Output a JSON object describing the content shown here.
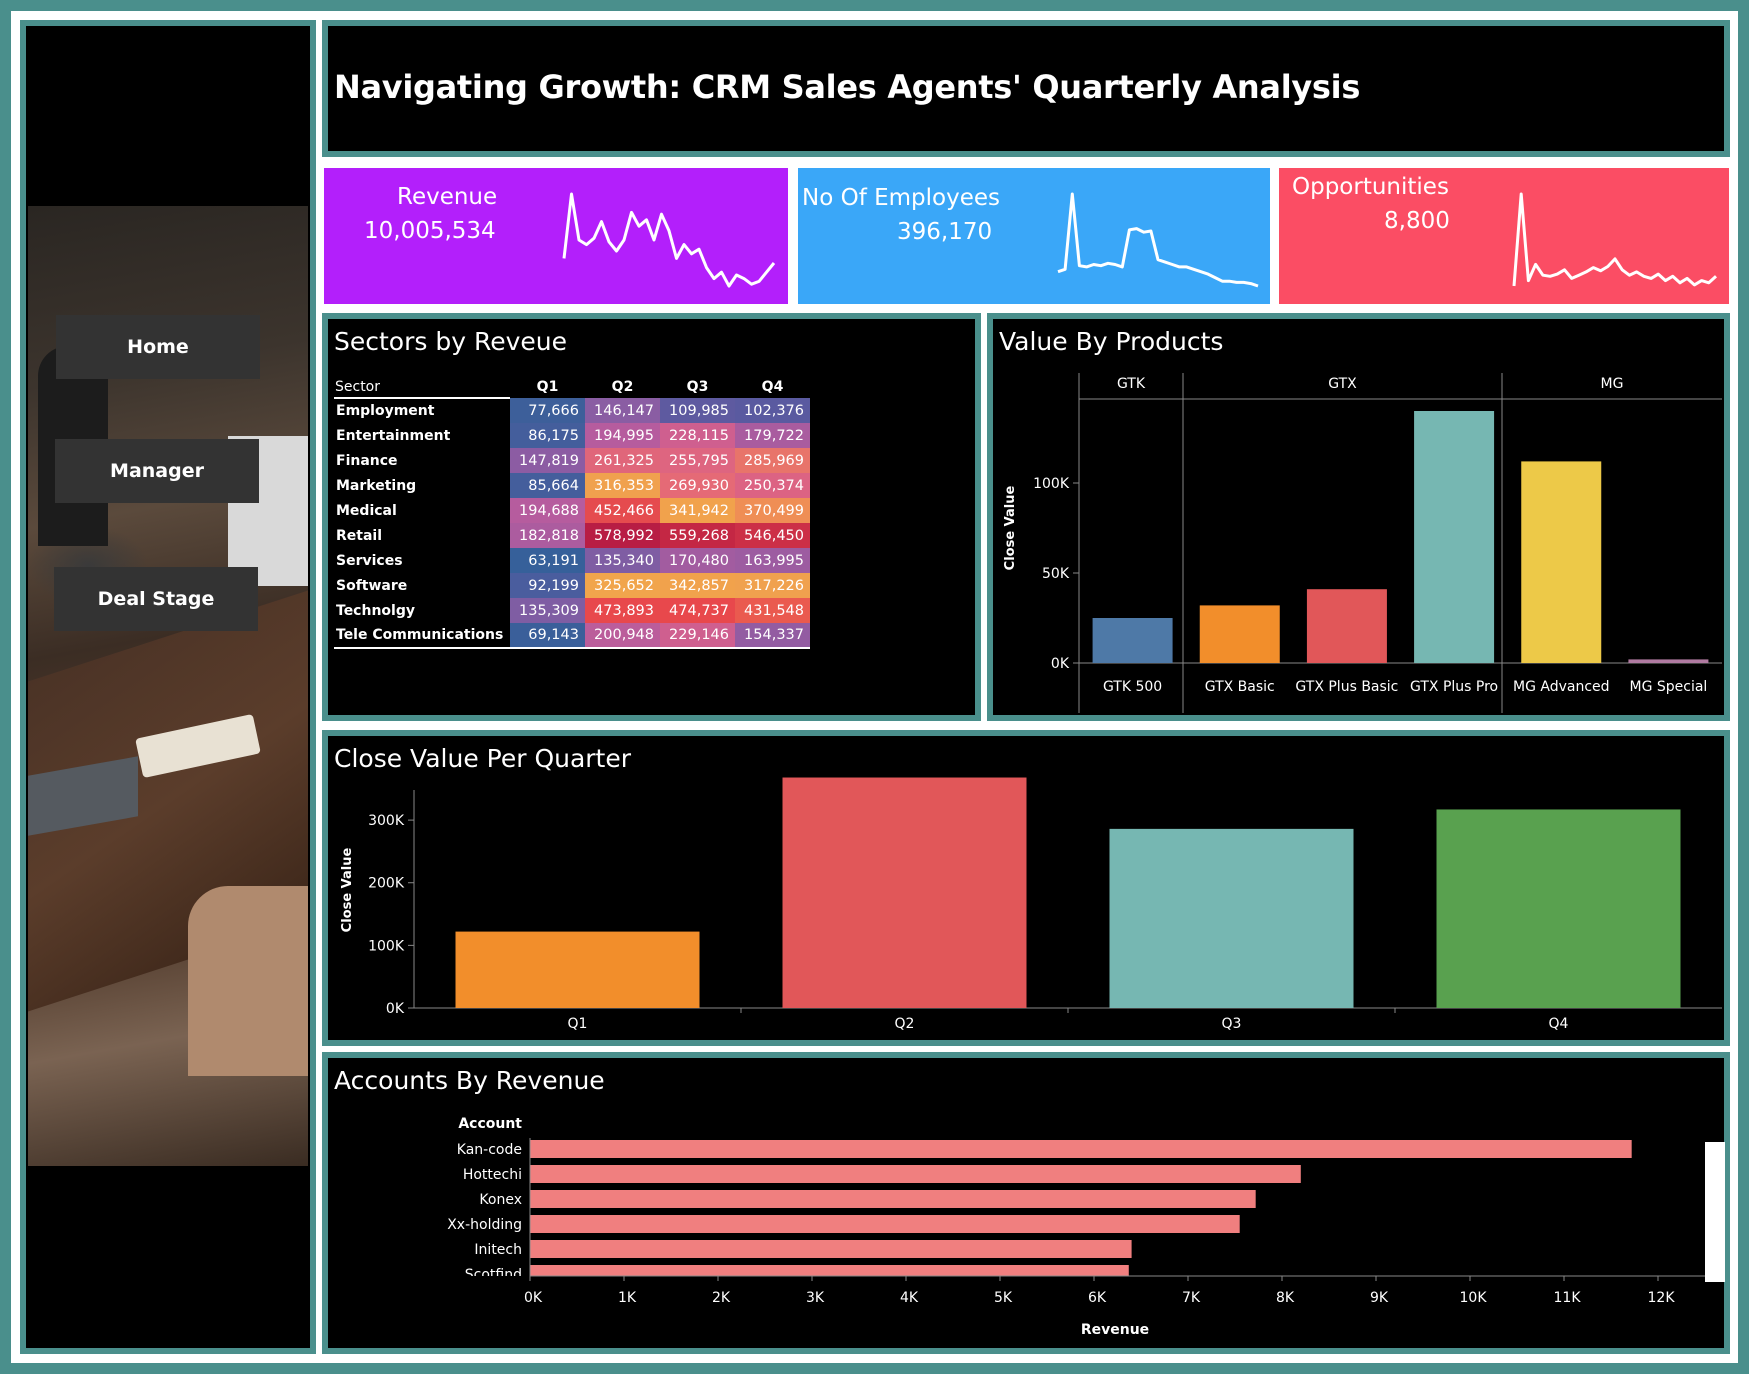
{
  "title": "Navigating Growth: CRM Sales Agents' Quarterly Analysis",
  "nav": {
    "home": "Home",
    "manager": "Manager",
    "deal_stage": "Deal Stage"
  },
  "kpis": {
    "revenue": {
      "label": "Revenue",
      "value": "10,005,534",
      "color": "#b31ffb",
      "spark": [
        40,
        110,
        60,
        55,
        62,
        80,
        58,
        48,
        60,
        90,
        75,
        82,
        60,
        88,
        70,
        40,
        55,
        45,
        50,
        30,
        18,
        25,
        10,
        22,
        18,
        12,
        15,
        25,
        35
      ]
    },
    "employees": {
      "label": "No Of Employees",
      "value": "396,170",
      "color": "#3aa7f8",
      "spark": [
        20,
        22,
        85,
        25,
        24,
        26,
        25,
        27,
        26,
        24,
        55,
        56,
        53,
        54,
        30,
        28,
        26,
        24,
        24,
        22,
        20,
        18,
        15,
        12,
        12,
        11,
        11,
        10,
        8
      ]
    },
    "opportunities": {
      "label": "Opportunities",
      "value": "8,800",
      "color": "#fb4d64",
      "spark": [
        15,
        100,
        20,
        35,
        25,
        24,
        26,
        30,
        22,
        25,
        28,
        32,
        29,
        33,
        40,
        30,
        25,
        28,
        24,
        22,
        26,
        20,
        24,
        18,
        22,
        16,
        20,
        18,
        24
      ]
    }
  },
  "sectors": {
    "title": "Sectors by Reveue",
    "header": [
      "Sector",
      "Q1",
      "Q2",
      "Q3",
      "Q4"
    ],
    "rows": [
      {
        "name": "Employment",
        "values": [
          "77,666",
          "146,147",
          "109,985",
          "102,376"
        ],
        "colors": [
          "#3d5f9a",
          "#8a5da3",
          "#5e5aa0",
          "#5a5aa0"
        ]
      },
      {
        "name": "Entertainment",
        "values": [
          "86,175",
          "194,995",
          "228,115",
          "179,722"
        ],
        "colors": [
          "#445e9c",
          "#b65c9e",
          "#cf5f8f",
          "#a95c9f"
        ]
      },
      {
        "name": "Finance",
        "values": [
          "147,819",
          "261,325",
          "255,795",
          "285,969"
        ],
        "colors": [
          "#8c5ca3",
          "#e0667a",
          "#de6580",
          "#e8746a"
        ]
      },
      {
        "name": "Marketing",
        "values": [
          "85,664",
          "316,353",
          "269,930",
          "250,374"
        ],
        "colors": [
          "#445e9c",
          "#f0a14e",
          "#e56a76",
          "#dc6383"
        ]
      },
      {
        "name": "Medical",
        "values": [
          "194,688",
          "452,466",
          "341,942",
          "370,499"
        ],
        "colors": [
          "#b65c9e",
          "#e54b4e",
          "#f1a24c",
          "#ef8e55"
        ]
      },
      {
        "name": "Retail",
        "values": [
          "182,818",
          "578,992",
          "559,268",
          "546,450"
        ],
        "colors": [
          "#ac5c9f",
          "#b81d44",
          "#c42744",
          "#cc2f47"
        ]
      },
      {
        "name": "Services",
        "values": [
          "63,191",
          "135,340",
          "170,480",
          "163,995"
        ],
        "colors": [
          "#36609a",
          "#7f5da3",
          "#a25ca0",
          "#9d5ca1"
        ]
      },
      {
        "name": "Software",
        "values": [
          "92,199",
          "325,652",
          "342,857",
          "317,226"
        ],
        "colors": [
          "#4a5d9e",
          "#f1a54c",
          "#f1a24c",
          "#f0a14e"
        ]
      },
      {
        "name": "Technolgy",
        "values": [
          "135,309",
          "473,893",
          "474,737",
          "431,548"
        ],
        "colors": [
          "#7f5da3",
          "#e8484c",
          "#e8484c",
          "#ea5a4f"
        ]
      },
      {
        "name": "Tele Communications",
        "values": [
          "69,143",
          "200,948",
          "229,146",
          "154,337"
        ],
        "colors": [
          "#3a5f9a",
          "#bb5d9b",
          "#cf5f8f",
          "#935ca2"
        ]
      }
    ]
  },
  "products": {
    "title": "Value By Products",
    "groups": [
      "GTK",
      "GTX",
      "MG"
    ],
    "ylabel": "Close Value",
    "yticks": [
      "0K",
      "50K",
      "100K"
    ],
    "items": [
      {
        "name": "GTK 500",
        "value": 25000,
        "color": "#4e79a7"
      },
      {
        "name": "GTX Basic",
        "value": 32000,
        "color": "#f28e2b"
      },
      {
        "name": "GTX Plus Basic",
        "value": 41000,
        "color": "#e15759"
      },
      {
        "name": "GTX Plus Pro",
        "value": 140000,
        "color": "#76b7b2"
      },
      {
        "name": "MG Advanced",
        "value": 112000,
        "color": "#edc948"
      },
      {
        "name": "MG Special",
        "value": 2000,
        "color": "#b07aa1"
      }
    ]
  },
  "quarters": {
    "title": "Close Value Per Quarter",
    "ylabel": "Close Value",
    "yticks": [
      "0K",
      "100K",
      "200K",
      "300K"
    ],
    "items": [
      {
        "name": "Q1",
        "value": 122000,
        "color": "#f28e2b"
      },
      {
        "name": "Q2",
        "value": 368000,
        "color": "#e15759"
      },
      {
        "name": "Q3",
        "value": 286000,
        "color": "#76b7b2"
      },
      {
        "name": "Q4",
        "value": 317000,
        "color": "#59a14f"
      }
    ]
  },
  "accounts": {
    "title": "Accounts By Revenue",
    "header": "Account",
    "xlabel": "Revenue",
    "xticks": [
      "0K",
      "1K",
      "2K",
      "3K",
      "4K",
      "5K",
      "6K",
      "7K",
      "8K",
      "9K",
      "10K",
      "11K",
      "12K"
    ],
    "items": [
      {
        "name": "Kan-code",
        "value": 11720
      },
      {
        "name": "Hottechi",
        "value": 8200
      },
      {
        "name": "Konex",
        "value": 7720
      },
      {
        "name": "Xx-holding",
        "value": 7550
      },
      {
        "name": "Initech",
        "value": 6400
      },
      {
        "name": "Scotfind",
        "value": 6370
      }
    ],
    "bar_color": "#f07f7f"
  },
  "chart_data": [
    {
      "type": "table",
      "title": "Sectors by Reveue",
      "columns": [
        "Sector",
        "Q1",
        "Q2",
        "Q3",
        "Q4"
      ],
      "rows": [
        [
          "Employment",
          77666,
          146147,
          109985,
          102376
        ],
        [
          "Entertainment",
          86175,
          194995,
          228115,
          179722
        ],
        [
          "Finance",
          147819,
          261325,
          255795,
          285969
        ],
        [
          "Marketing",
          85664,
          316353,
          269930,
          250374
        ],
        [
          "Medical",
          194688,
          452466,
          341942,
          370499
        ],
        [
          "Retail",
          182818,
          578992,
          559268,
          546450
        ],
        [
          "Services",
          63191,
          135340,
          170480,
          163995
        ],
        [
          "Software",
          92199,
          325652,
          342857,
          317226
        ],
        [
          "Technolgy",
          135309,
          473893,
          474737,
          431548
        ],
        [
          "Tele Communications",
          69143,
          200948,
          229146,
          154337
        ]
      ]
    },
    {
      "type": "bar",
      "title": "Value By Products",
      "categories": [
        "GTK 500",
        "GTX Basic",
        "GTX Plus Basic",
        "GTX Plus Pro",
        "MG Advanced",
        "MG Special"
      ],
      "values": [
        25000,
        32000,
        41000,
        140000,
        112000,
        2000
      ],
      "ylabel": "Close Value",
      "ylim": [
        0,
        150000
      ]
    },
    {
      "type": "bar",
      "title": "Close Value Per Quarter",
      "categories": [
        "Q1",
        "Q2",
        "Q3",
        "Q4"
      ],
      "values": [
        122000,
        368000,
        286000,
        317000
      ],
      "ylabel": "Close Value",
      "ylim": [
        0,
        380000
      ]
    },
    {
      "type": "bar",
      "title": "Accounts By Revenue",
      "categories": [
        "Kan-code",
        "Hottechi",
        "Konex",
        "Xx-holding",
        "Initech",
        "Scotfind"
      ],
      "values": [
        11720,
        8200,
        7720,
        7550,
        6400,
        6370
      ],
      "xlabel": "Revenue",
      "xlim": [
        0,
        12500
      ]
    }
  ]
}
